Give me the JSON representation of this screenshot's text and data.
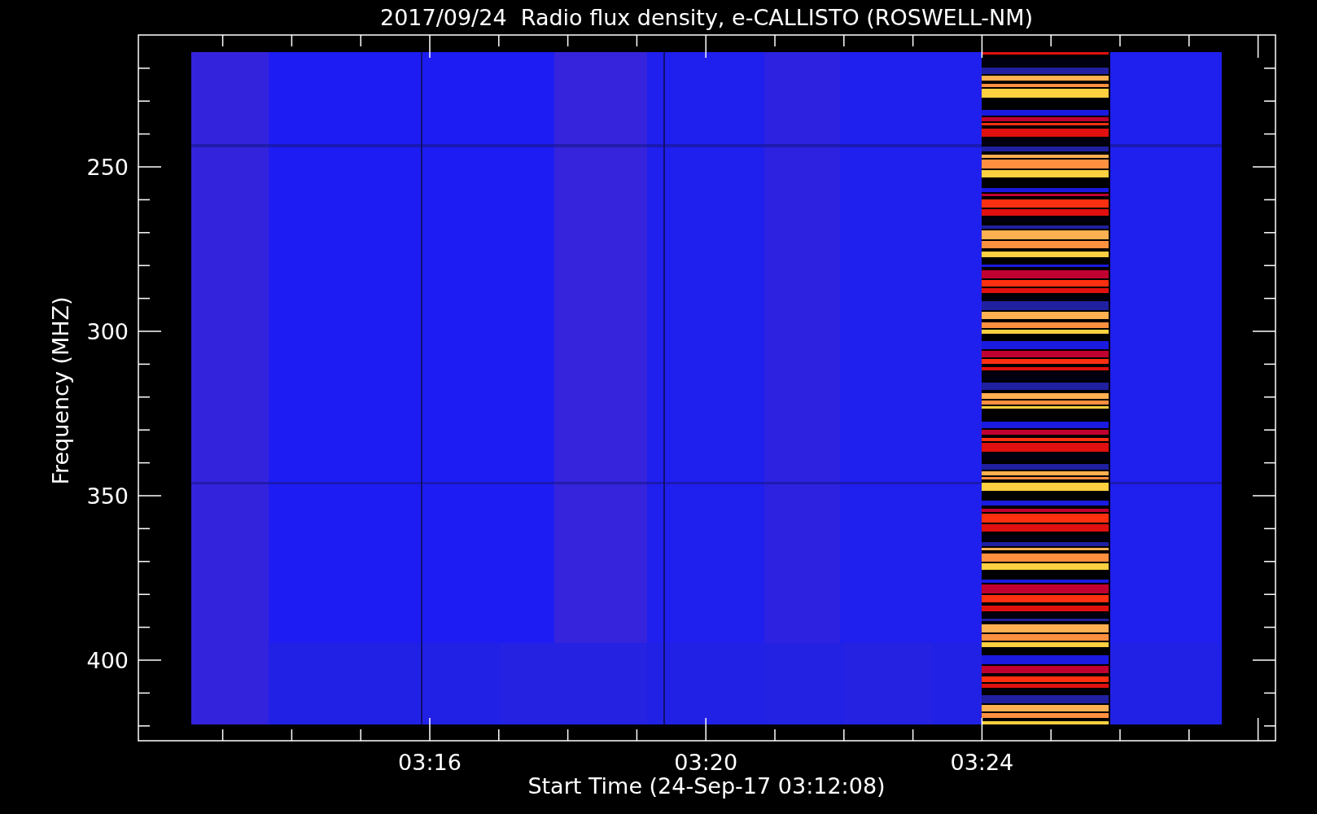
{
  "title": "2017/09/24  Radio flux density, e-CALLISTO (ROSWELL-NM)",
  "y_axis": {
    "label": "Frequency (MHZ)",
    "ticks": [
      "250",
      "300",
      "350",
      "400"
    ]
  },
  "x_axis": {
    "label": "Start Time (24-Sep-17 03:12:08)",
    "ticks": [
      "03:16",
      "03:20",
      "03:24"
    ]
  }
}
